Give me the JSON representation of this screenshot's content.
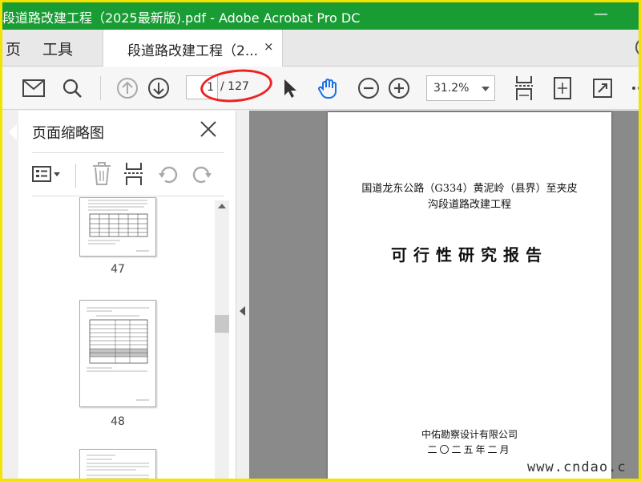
{
  "window": {
    "title": "段道路改建工程（2025最新版).pdf - Adobe Acrobat Pro DC",
    "minimize_glyph": "—"
  },
  "tabs": {
    "nav_home": "页",
    "nav_tools": "工具",
    "doc_tab_label": "段道路改建工程（2...",
    "close_glyph": "×"
  },
  "toolbar": {
    "page_current": "1",
    "page_total": "/ 127",
    "zoom": "31.2%"
  },
  "sidebar": {
    "title": "页面缩略图",
    "thumbnails": [
      {
        "page": "47"
      },
      {
        "page": "48"
      }
    ]
  },
  "document": {
    "line1": "国道龙东公路（G334）黄泥岭（县界）至夹皮",
    "line2": "沟段道路改建工程",
    "heading": "可行性研究报告",
    "company": "中佑勘察设计有限公司",
    "date": "二〇二五年二月"
  },
  "site_watermark": "www.cndao.c",
  "colors": {
    "titlebar": "#1a9c35",
    "accent_blue": "#1473e6",
    "annotation_red": "#e22222"
  }
}
